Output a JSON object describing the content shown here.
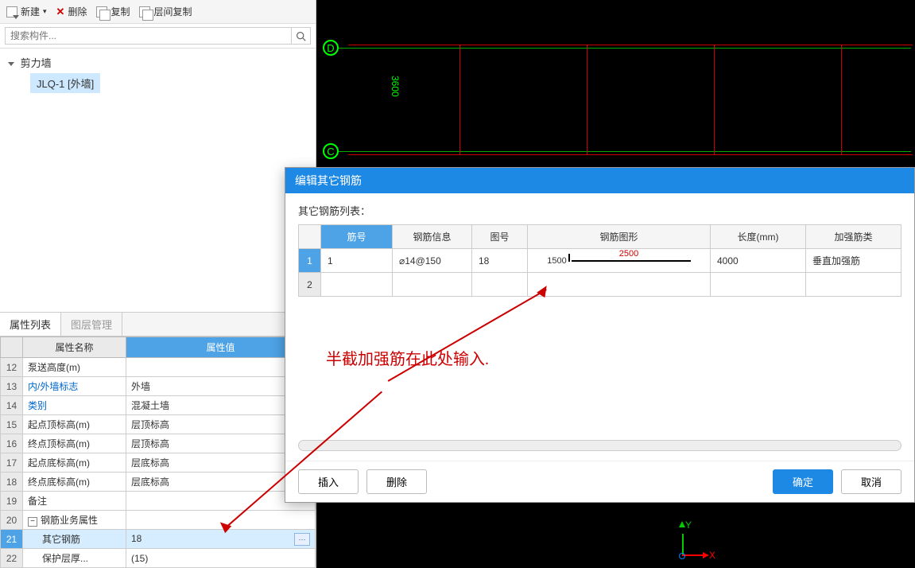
{
  "toolbar": {
    "new_label": "新建",
    "delete_label": "删除",
    "copy_label": "复制",
    "layer_copy_label": "层间复制"
  },
  "search": {
    "placeholder": "搜索构件..."
  },
  "tree": {
    "root": "剪力墙",
    "child": "JLQ-1 [外墙]"
  },
  "tabs": {
    "props": "属性列表",
    "layers": "图层管理"
  },
  "prop_header": {
    "name": "属性名称",
    "value": "属性值"
  },
  "props": [
    {
      "n": "12",
      "name": "泵送高度(m)",
      "val": "",
      "cls": ""
    },
    {
      "n": "13",
      "name": "内/外墙标志",
      "val": "外墙",
      "cls": "blue-text"
    },
    {
      "n": "14",
      "name": "类别",
      "val": "混凝土墙",
      "cls": "blue-text"
    },
    {
      "n": "15",
      "name": "起点顶标高(m)",
      "val": "层顶标高",
      "cls": ""
    },
    {
      "n": "16",
      "name": "终点顶标高(m)",
      "val": "层顶标高",
      "cls": ""
    },
    {
      "n": "17",
      "name": "起点底标高(m)",
      "val": "层底标高",
      "cls": ""
    },
    {
      "n": "18",
      "name": "终点底标高(m)",
      "val": "层底标高",
      "cls": ""
    },
    {
      "n": "19",
      "name": "备注",
      "val": "",
      "cls": ""
    },
    {
      "n": "20",
      "name": "钢筋业务属性",
      "val": "",
      "cls": "",
      "expand": true
    },
    {
      "n": "21",
      "name": "其它钢筋",
      "val": "18",
      "cls": "",
      "selected": true,
      "ellipsis": true
    },
    {
      "n": "22",
      "name": "保护层厚...",
      "val": "(15)",
      "cls": ""
    }
  ],
  "canvas": {
    "label_d": "D",
    "label_c": "C",
    "dim": "3600",
    "axis_y": "Y",
    "axis_x": "X"
  },
  "dialog": {
    "title": "编辑其它钢筋",
    "subtitle": "其它钢筋列表：",
    "headers": {
      "num": "筋号",
      "info": "钢筋信息",
      "fig": "图号",
      "shape": "钢筋图形",
      "len": "长度(mm)",
      "type": "加强筋类"
    },
    "rows": [
      {
        "rn": "1",
        "num": "1",
        "info": "⌀14@150",
        "fig": "18",
        "shape_left": "1500",
        "shape_mid": "2500",
        "len": "4000",
        "type": "垂直加强筋"
      },
      {
        "rn": "2",
        "num": "",
        "info": "",
        "fig": "",
        "shape_left": "",
        "shape_mid": "",
        "len": "",
        "type": ""
      }
    ],
    "btn_insert": "插入",
    "btn_delete": "删除",
    "btn_ok": "确定",
    "btn_cancel": "取消"
  },
  "annotation": "半截加强筋在此处输入."
}
